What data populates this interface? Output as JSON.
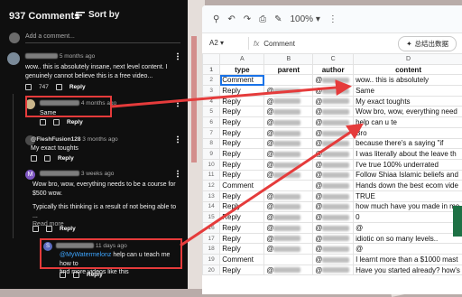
{
  "youtube": {
    "comment_count": "937 Comments",
    "sort_label": "Sort by",
    "add_placeholder": "Add a comment...",
    "reply_label": "Reply",
    "comments": [
      {
        "time": "5 months ago",
        "lines": [
          "wow.. this is absolutely insane, next level content. I",
          "genuinely cannot believe this is a free video..."
        ],
        "likes": "747",
        "avatar_color": "#7a8a99"
      },
      {
        "time": "4 months ago",
        "lines": [
          "Same"
        ],
        "likes": "",
        "avatar_color": "#c9b58a"
      },
      {
        "handle": "@FleshFusion128",
        "time": "3 months ago",
        "lines": [
          "My exact toughts"
        ],
        "likes": "",
        "avatar_color": "#4a4a4a"
      },
      {
        "avatar_letter": "M",
        "time": "3 weeks ago",
        "lines": [
          "Wow bro, wow, everything needs to be a course for",
          "$500 wow.",
          "",
          "Typically this thinking is a result of not being able to ..."
        ],
        "read_more": "Read more",
        "likes": "",
        "avatar_color": "#7e57c2"
      },
      {
        "avatar_letter": "S",
        "time": "11 days ago",
        "mention": "@MyWatermelonz",
        "lines": [
          "help can u teach me how to",
          "find more videos like this"
        ],
        "likes": "",
        "avatar_color": "#5c6bc0"
      }
    ]
  },
  "sheet": {
    "zoom": "100%",
    "cell_ref": "A2",
    "fx": "fx",
    "formula_value": "Comment",
    "ai_button": "总结出数据",
    "columns": [
      "A",
      "B",
      "C",
      "D"
    ],
    "headers": [
      "type",
      "parent",
      "author",
      "content"
    ],
    "rows": [
      {
        "n": "2",
        "type": "Comment",
        "parent": "",
        "author": "@",
        "content": "wow.. this is absolutely"
      },
      {
        "n": "3",
        "type": "Reply",
        "parent": "@",
        "author": "@",
        "content": "Same"
      },
      {
        "n": "4",
        "type": "Reply",
        "parent": "@",
        "author": "@",
        "content": "My exact toughts"
      },
      {
        "n": "5",
        "type": "Reply",
        "parent": "@",
        "author": "@",
        "content": "Wow bro, wow, everything need"
      },
      {
        "n": "6",
        "type": "Reply",
        "parent": "@",
        "author": "@",
        "content": "help can u te"
      },
      {
        "n": "7",
        "type": "Reply",
        "parent": "@",
        "author": "@",
        "content": "Bro"
      },
      {
        "n": "8",
        "type": "Reply",
        "parent": "@",
        "author": "@",
        "content": "because there's a saying \"if"
      },
      {
        "n": "9",
        "type": "Reply",
        "parent": "@",
        "author": "@",
        "content": "I was literally about the leave th"
      },
      {
        "n": "10",
        "type": "Reply",
        "parent": "@",
        "author": "@",
        "content": "I've true 100% underrated"
      },
      {
        "n": "11",
        "type": "Reply",
        "parent": "@",
        "author": "@",
        "content": "Follow Shiaa Islamic beliefs and"
      },
      {
        "n": "12",
        "type": "Comment",
        "parent": "",
        "author": "@",
        "content": "Hands down the best ecom vide"
      },
      {
        "n": "13",
        "type": "Reply",
        "parent": "@",
        "author": "@",
        "content": "TRUE"
      },
      {
        "n": "14",
        "type": "Reply",
        "parent": "@",
        "author": "@",
        "content": "how much have you made in mo"
      },
      {
        "n": "15",
        "type": "Reply",
        "parent": "@",
        "author": "@",
        "content": "0"
      },
      {
        "n": "16",
        "type": "Reply",
        "parent": "@",
        "author": "@",
        "content": "@"
      },
      {
        "n": "17",
        "type": "Reply",
        "parent": "@",
        "author": "@",
        "content": "idiotic on so many levels.."
      },
      {
        "n": "18",
        "type": "Reply",
        "parent": "@",
        "author": "@",
        "content": "@"
      },
      {
        "n": "19",
        "type": "Comment",
        "parent": "",
        "author": "@",
        "content": "I learnt more than a $1000 mast"
      },
      {
        "n": "20",
        "type": "Reply",
        "parent": "@",
        "author": "@",
        "content": "Have you started already? how's"
      }
    ]
  },
  "colors": {
    "highlight": "#e53b3b",
    "link": "#3ea6ff",
    "selection": "#1a73e8"
  }
}
